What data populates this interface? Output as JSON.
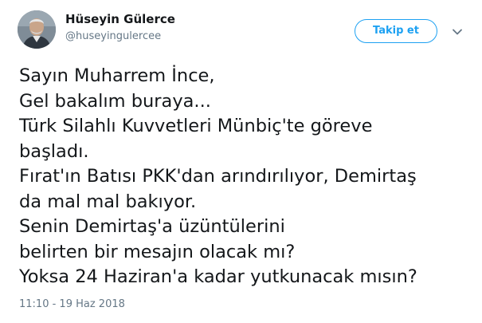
{
  "author": {
    "name": "Hüseyin Gülerce",
    "handle": "@huseyingulercee"
  },
  "follow_button": {
    "label": "Takip et"
  },
  "icons": {
    "avatar": "profile-photo",
    "menu": "chevron-down-icon"
  },
  "tweet": {
    "lines": [
      "Sayın Muharrem İnce,",
      "Gel bakalım buraya...",
      "Türk Silahlı Kuvvetleri Münbiç'te göreve",
      "başladı.",
      "Fırat'ın Batısı PKK'dan arındırılıyor, Demirtaş",
      "da mal mal bakıyor.",
      "Senin Demirtaş'a üzüntülerini",
      "belirten bir mesajın olacak mı?",
      "Yoksa 24 Haziran'a kadar yutkunacak mısın?"
    ],
    "timestamp": "11:10 - 19 Haz 2018"
  },
  "colors": {
    "accent": "#1da1f2",
    "text_primary": "#14171a",
    "text_secondary": "#657786"
  }
}
